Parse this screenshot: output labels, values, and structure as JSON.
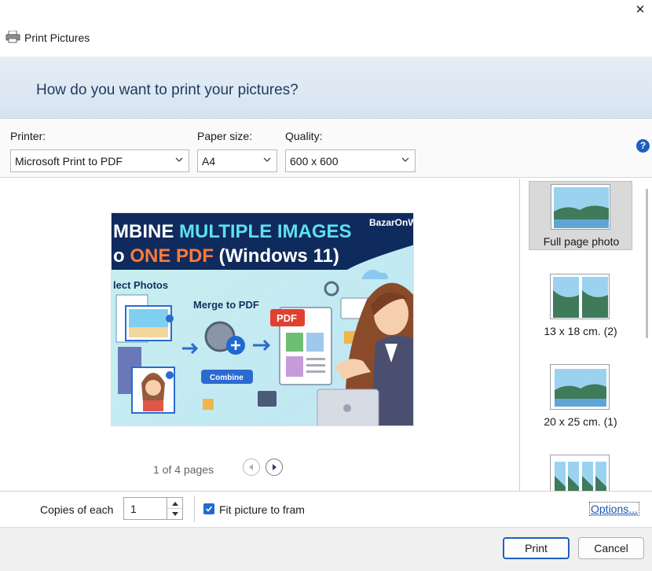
{
  "window": {
    "title": "Print Pictures",
    "close_glyph": "✕"
  },
  "header": {
    "question": "How do you want to print your pictures?"
  },
  "controls": {
    "printer_label": "Printer:",
    "printer_value": "Microsoft Print to PDF",
    "paper_label": "Paper size:",
    "paper_value": "A4",
    "quality_label": "Quality:",
    "quality_value": "600 x 600",
    "help_glyph": "?"
  },
  "preview": {
    "image": {
      "banner_line1a": "MBINE ",
      "banner_line1b": "MULTIPLE IMAGES",
      "banner_line2a": "o ",
      "banner_line2b": "ONE PDF",
      "banner_line2c": " (Windows 11)",
      "brand": "BazarOnW",
      "select_photos": "lect Photos",
      "merge_to_pdf": "Merge to PDF",
      "pdf_tag": "PDF",
      "combine": "Combine"
    },
    "page_info": "1 of 4 pages"
  },
  "layouts": [
    {
      "label": "Full page photo",
      "selected": true
    },
    {
      "label": "13 x 18 cm. (2)",
      "selected": false
    },
    {
      "label": "20 x 25 cm. (1)",
      "selected": false
    },
    {
      "label": "",
      "selected": false
    }
  ],
  "copies": {
    "label": "Copies of each",
    "value": "1"
  },
  "fit": {
    "label": "Fit picture to fram",
    "checked": true
  },
  "options_link": "Options...",
  "buttons": {
    "print": "Print",
    "cancel": "Cancel"
  },
  "colors": {
    "accent": "#1f5fbf",
    "header_bg": "#dde8f3"
  }
}
